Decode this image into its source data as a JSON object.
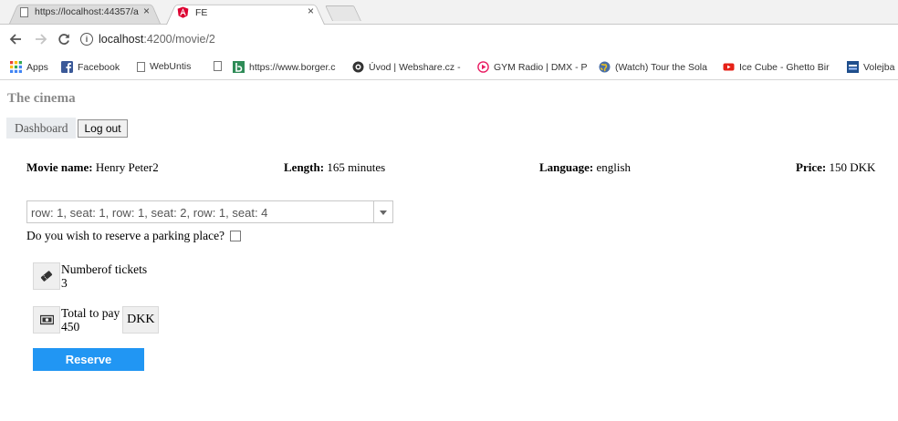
{
  "browser": {
    "tabs": [
      {
        "title": "https://localhost:44357/a",
        "close": "×"
      },
      {
        "title": "FE",
        "close": "×"
      }
    ],
    "omnibox": {
      "host": "localhost",
      "path": ":4200/movie/2"
    },
    "bookmarks": [
      {
        "label": "Apps",
        "icon": "apps-grid-icon"
      },
      {
        "label": "Facebook",
        "icon": "facebook-icon"
      },
      {
        "label": "WebUntis",
        "icon": "page-icon"
      },
      {
        "label": "",
        "icon": "page-icon"
      },
      {
        "label": "https://www.borger.c",
        "icon": "borger-icon"
      },
      {
        "label": "Úvod | Webshare.cz -",
        "icon": "webshare-icon"
      },
      {
        "label": "GYM Radio | DMX - P",
        "icon": "radio-icon"
      },
      {
        "label": "(Watch) Tour the Sola",
        "icon": "globe-icon"
      },
      {
        "label": "Ice Cube - Ghetto Bir",
        "icon": "youtube-icon"
      },
      {
        "label": "Volejba",
        "icon": "volejbal-icon"
      }
    ],
    "colors": {
      "facebook": "#3b5998",
      "youtube": "#e62117",
      "angular": "#dd0031",
      "borger": "#2e8b57"
    }
  },
  "page": {
    "site_title": "The cinema",
    "nav": {
      "dashboard": "Dashboard",
      "logout": "Log out"
    },
    "movie": {
      "name_label": "Movie name:",
      "name": "Henry Peter2",
      "length_label": "Length:",
      "length": "165 minutes",
      "language_label": "Language:",
      "language": "english",
      "price_label": "Price:",
      "price": "150 DKK"
    },
    "seats": {
      "selected": "row: 1, seat: 1, row: 1, seat: 2, row: 1, seat: 4"
    },
    "parking": {
      "label": "Do you wish to reserve a parking place?",
      "checked": false
    },
    "tickets": {
      "label": "Numberof tickets",
      "value": "3",
      "icon": "ticket-icon"
    },
    "total": {
      "label": "Total to pay",
      "value": "450",
      "currency": "DKK",
      "icon": "money-icon"
    },
    "reserve_label": "Reserve",
    "accent": "#2196f3"
  }
}
